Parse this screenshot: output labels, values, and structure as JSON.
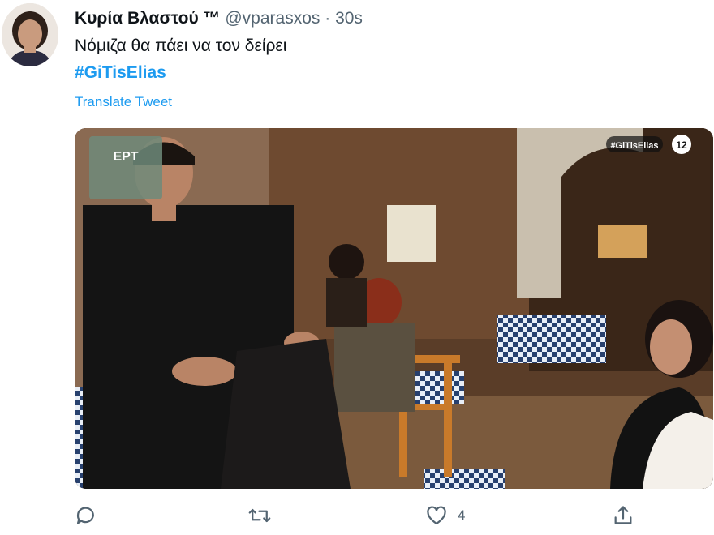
{
  "author": {
    "display_name": "Κυρία Βλαστού ™",
    "handle": "@vparasxos",
    "separator": "·",
    "time": "30s",
    "avatar_icon": "profile-avatar"
  },
  "tweet": {
    "text": "Νόμιζα θα πάει να τον δείρει",
    "hashtag": "#GiTisElias",
    "translate_label": "Translate Tweet"
  },
  "media": {
    "overlay_badge_left": "ΕΡΤ",
    "overlay_badge_right": "#GiTisElias",
    "channel_logo": "12"
  },
  "actions": {
    "reply_icon": "reply-icon",
    "retweet_icon": "retweet-icon",
    "like_icon": "heart-icon",
    "like_count": "4",
    "share_icon": "share-icon"
  },
  "colors": {
    "accent": "#1d9bf0",
    "secondary_text": "#536471"
  }
}
